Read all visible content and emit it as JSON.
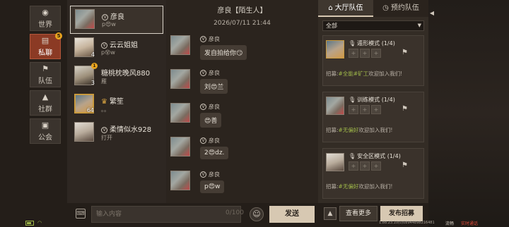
{
  "nav": {
    "items": [
      {
        "label": "世界",
        "icon": "globe-icon"
      },
      {
        "label": "私聊",
        "icon": "chat-icon",
        "badge": "5"
      },
      {
        "label": "队伍",
        "icon": "flag-icon"
      },
      {
        "label": "社群",
        "icon": "community-icon"
      },
      {
        "label": "公会",
        "icon": "guild-icon"
      }
    ]
  },
  "contacts": [
    {
      "name": "彦良",
      "preview": "p😍w",
      "vip": "V",
      "selected": true
    },
    {
      "name": "云云姐姐",
      "preview": "p😵w",
      "vip": "V",
      "level": "4"
    },
    {
      "name": "糖桃枕晚风880",
      "preview": "雁",
      "badge": "1",
      "level": "3"
    },
    {
      "name": "繁笙",
      "preview": "。。",
      "level": "64",
      "crown": true
    },
    {
      "name": "柔情似水928",
      "preview": "打开",
      "vip": "V"
    }
  ],
  "chat": {
    "title": "彦良【陌生人】",
    "date": "2026/07/11 21:44",
    "messages": [
      {
        "name": "彦良",
        "text": "发自拍给你😏"
      },
      {
        "name": "彦良",
        "text": "刘😍兰"
      },
      {
        "name": "彦良",
        "text": "😍善"
      },
      {
        "name": "彦良",
        "text": "2😍dz."
      },
      {
        "name": "彦良",
        "text": "p😍w"
      }
    ]
  },
  "input": {
    "placeholder": "输入内容",
    "count": "0/100",
    "send_label": "发送"
  },
  "right": {
    "tab_lobby": "大厅队伍",
    "tab_reserve": "预约队伍",
    "filter_value": "全部",
    "teams": [
      {
        "mode": "遁形模式 (1/4)",
        "msg_prefix": "招募:",
        "msg_tag": "#全能#矿工",
        "msg_suffix": "欢迎加入我们!"
      },
      {
        "mode": "训练模式 (1/4)",
        "msg_prefix": "招募:",
        "msg_tag": "#无偏好",
        "msg_suffix": "欢迎加入我们!"
      },
      {
        "mode": "安全区模式 (1/4)",
        "msg_prefix": "招募:",
        "msg_tag": "#无偏好",
        "msg_suffix": "欢迎加入我们!"
      }
    ],
    "more_label": "查看更多",
    "recruit_label": "发布招募"
  },
  "system": {
    "version": "1.88.23.10(0)08944898216481",
    "label_a": "流畅",
    "label_b": "实时通话"
  },
  "colors": {
    "accent": "#8b3a24",
    "tag_green": "#9fb84a",
    "send": "#d7c8b2"
  }
}
